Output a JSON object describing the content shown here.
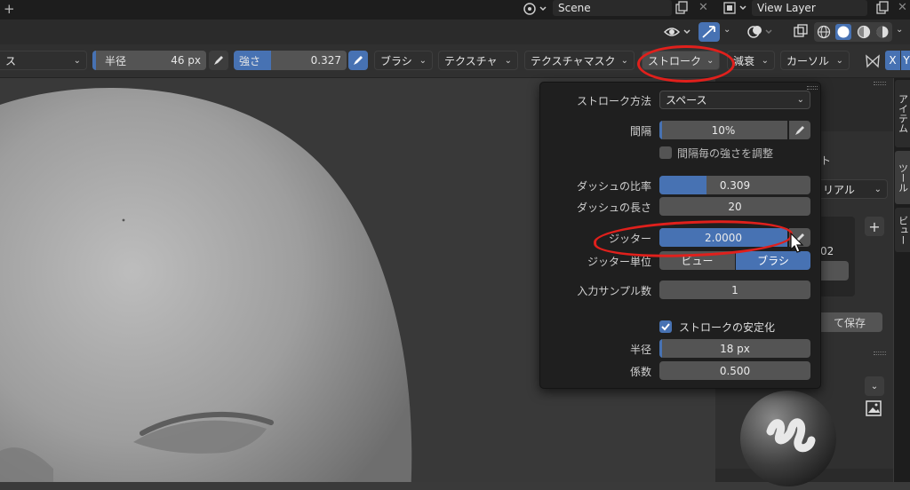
{
  "topbar": {
    "plus": "+",
    "scene_name": "Scene",
    "view_layer": "View Layer"
  },
  "toolbar": {
    "left_partial": "ス",
    "radius_label": "半径",
    "radius_value": "46 px",
    "strength_label": "強さ",
    "strength_value": "0.327",
    "brush": "ブラシ",
    "texture": "テクスチャ",
    "texture_mask": "テクスチャマスク",
    "stroke": "ストローク",
    "falloff": "減衰",
    "cursor": "カーソル",
    "x_axis": "X",
    "y_axis": "Y"
  },
  "popup": {
    "stroke_method_label": "ストローク方法",
    "stroke_method_value": "スペース",
    "spacing_label": "間隔",
    "spacing_value": "10%",
    "spacing_fill": 0.02,
    "adjust_strength_label": "間隔毎の強さを調整",
    "dash_ratio_label": "ダッシュの比率",
    "dash_ratio_value": "0.309",
    "dash_ratio_fill": 0.309,
    "dash_length_label": "ダッシュの長さ",
    "dash_length_value": "20",
    "jitter_label": "ジッター",
    "jitter_value": "2.0000",
    "jitter_fill": 1.0,
    "jitter_unit_label": "ジッター単位",
    "jitter_unit_view": "ビュー",
    "jitter_unit_brush": "ブラシ",
    "input_samples_label": "入力サンプル数",
    "input_samples_value": "1",
    "stabilize_label": "ストロークの安定化",
    "stab_radius_label": "半径",
    "stab_radius_value": "18 px",
    "stab_radius_fill": 0.02,
    "factor_label": "係数",
    "factor_value": "0.500"
  },
  "rightpanel": {
    "partial_t": "ト",
    "material_partial": "リアル",
    "num_partial": "02",
    "save_partial": "て保存",
    "plus": "+"
  },
  "vtabs": {
    "item": "アイテム",
    "tool": "ツール",
    "view": "ビュー"
  },
  "colors": {
    "accent": "#4772b3",
    "annotation": "#e0201c"
  }
}
